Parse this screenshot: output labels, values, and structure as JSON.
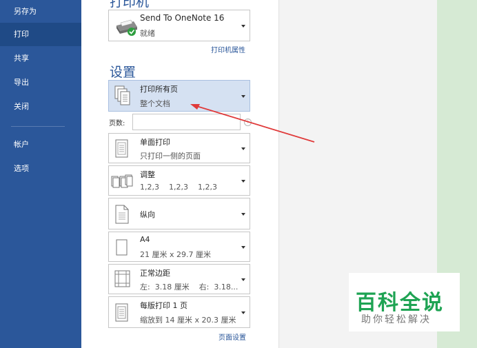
{
  "nav": {
    "items": [
      {
        "label": "另存为",
        "active": false
      },
      {
        "label": "打印",
        "active": true
      },
      {
        "label": "共享",
        "active": false
      },
      {
        "label": "导出",
        "active": false
      },
      {
        "label": "关闭",
        "active": false
      },
      {
        "label": "帐户",
        "active": false
      },
      {
        "label": "选项",
        "active": false
      }
    ]
  },
  "printer": {
    "section_title": "打印机",
    "name": "Send To OneNote 16",
    "status": "就绪",
    "icon": "printer-ready-icon",
    "properties_link": "打印机属性"
  },
  "settings": {
    "section_title": "设置",
    "print_range": {
      "main": "打印所有页",
      "sub": "整个文档",
      "icon": "all-pages-icon"
    },
    "pages_label": "页数:",
    "pages_value": "",
    "sides": {
      "main": "单面打印",
      "sub": "只打印一侧的页面",
      "icon": "one-sided-icon"
    },
    "collate": {
      "main": "调整",
      "sub": "1,2,3    1,2,3    1,2,3",
      "icon": "collated-icon"
    },
    "orientation": {
      "main": "纵向",
      "icon": "portrait-icon"
    },
    "paper": {
      "main": "A4",
      "sub": "21 厘米 x 29.7 厘米",
      "icon": "paper-size-icon"
    },
    "margins": {
      "main": "正常边距",
      "sub": "左:  3.18 厘米    右:  3.18...",
      "icon": "margins-icon"
    },
    "per_sheet": {
      "main": "每版打印 1 页",
      "sub": "缩放到 14 厘米 x 20.3 厘米",
      "icon": "pages-per-sheet-icon"
    },
    "page_setup_link": "页面设置"
  },
  "watermark": {
    "title": "百科全说",
    "subtitle": "助你轻松解决"
  },
  "colors": {
    "nav_bg": "#2b579a",
    "accent": "#2b579a",
    "highlight": "#d5e1f2",
    "arrow": "#e03a3a",
    "watermark_green": "#1ea353"
  }
}
